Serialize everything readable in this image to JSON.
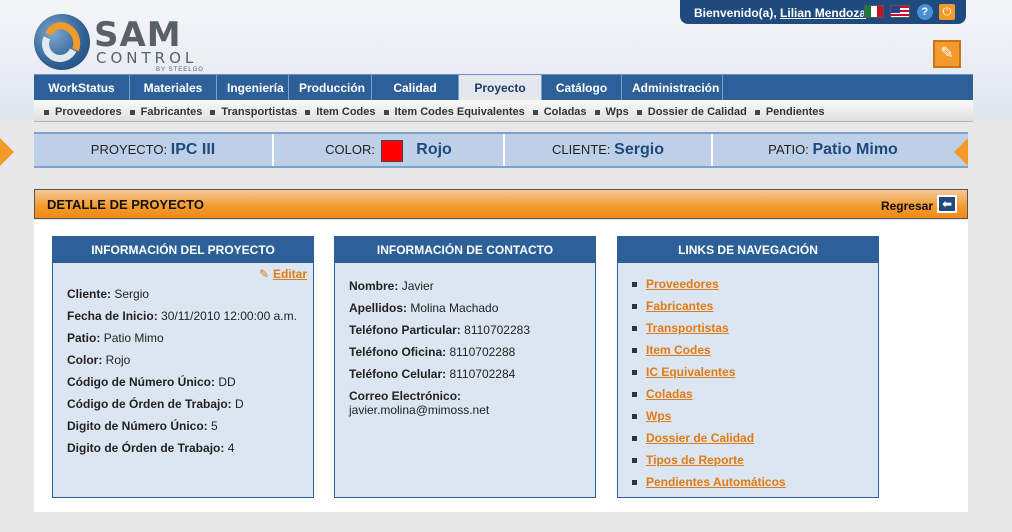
{
  "logo": {
    "name": "SAM",
    "sub": "CONTROL",
    "by": "BY STEELGO"
  },
  "header": {
    "welcome": "Bienvenido(a),",
    "user": "Lilian Mendoza"
  },
  "mainnav": [
    "WorkStatus",
    "Materiales",
    "Ingeniería",
    "Producción",
    "Calidad",
    "Proyecto",
    "Catálogo",
    "Administración"
  ],
  "mainnav_active": "Proyecto",
  "subnav": [
    "Proveedores",
    "Fabricantes",
    "Transportistas",
    "Item Codes",
    "Item Codes Equivalentes",
    "Coladas",
    "Wps",
    "Dossier de Calidad",
    "Pendientes"
  ],
  "project_bar": {
    "proyecto_label": "PROYECTO:",
    "proyecto": "IPC III",
    "color_label": "COLOR:",
    "color": "Rojo",
    "color_hex": "#ff0000",
    "cliente_label": "CLIENTE:",
    "cliente": "Sergio",
    "patio_label": "PATIO:",
    "patio": "Patio Mimo"
  },
  "detail": {
    "title": "DETALLE DE PROYECTO",
    "back": "Regresar"
  },
  "info_panel": {
    "title": "INFORMACIÓN DEL PROYECTO",
    "edit": "Editar",
    "rows": [
      {
        "label": "Cliente:",
        "value": "Sergio"
      },
      {
        "label": "Fecha de Inicio:",
        "value": "30/11/2010 12:00:00 a.m."
      },
      {
        "label": "Patio:",
        "value": "Patio Mimo"
      },
      {
        "label": "Color:",
        "value": "Rojo"
      },
      {
        "label": "Código de Número Único:",
        "value": "DD"
      },
      {
        "label": "Código de Órden de Trabajo:",
        "value": "D"
      },
      {
        "label": "Digito de Número Único:",
        "value": "5"
      },
      {
        "label": "Digito de Órden de Trabajo:",
        "value": "4"
      }
    ]
  },
  "contact_panel": {
    "title": "INFORMACIÓN DE CONTACTO",
    "rows": [
      {
        "label": "Nombre:",
        "value": "Javier"
      },
      {
        "label": "Apellidos:",
        "value": "Molina Machado"
      },
      {
        "label": "Teléfono Particular:",
        "value": "8110702283"
      },
      {
        "label": "Teléfono Oficina:",
        "value": "8110702288"
      },
      {
        "label": "Teléfono Celular:",
        "value": "8110702284"
      }
    ],
    "email_label": "Correo Electrónico:",
    "email": "javier.molina@mimoss.net"
  },
  "links_panel": {
    "title": "LINKS DE NAVEGACIÓN",
    "links": [
      "Proveedores",
      "Fabricantes",
      "Transportistas",
      "Item Codes",
      "IC Equivalentes",
      "Coladas",
      "Wps",
      "Dossier de Calidad",
      "Tipos de Reporte",
      "Pendientes Automáticos"
    ]
  },
  "colors": {
    "nav_blue": "#2d5f99",
    "accent_orange": "#f39a2b",
    "link_orange": "#e07a12"
  }
}
